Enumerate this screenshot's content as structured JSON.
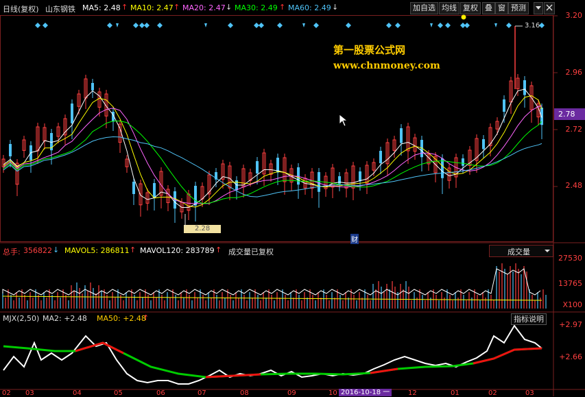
{
  "header": {
    "period": "日线(复权)",
    "stock": "山东钢铁",
    "ma5": "MA5: 2.48",
    "ma10": "MA10: 2.47",
    "ma20": "MA20: 2.47",
    "ma30": "MA30: 2.49",
    "ma60": "MA60: 2.49",
    "buttons": [
      "加自选",
      "均线",
      "复权",
      "叠",
      "窗",
      "预测"
    ],
    "close_icon": "x-icon",
    "colors": {
      "ma5": "#ffffff",
      "ma10": "#ffff00",
      "ma20": "#ff66ff",
      "ma30": "#00ff00",
      "ma60": "#4fc3f7"
    }
  },
  "price_axis": {
    "ticks": [
      "3.20",
      "2.96",
      "2.72",
      "2.48"
    ],
    "current": "2.78",
    "high_label": "3.16",
    "low_label": "2.28"
  },
  "watermark": {
    "title": "第一股票公式网",
    "url": "www.chnmoney.com"
  },
  "fin_marker": "财",
  "volume_panel": {
    "total_label": "总手:",
    "total_value": "356822",
    "mavol5": "MAVOL5: 286811",
    "mavol120": "MAVOL120: 283789",
    "note": "成交量已复权",
    "dropdown": "成交量",
    "ticks": [
      "27530",
      "13765",
      "X100"
    ]
  },
  "indicator_panel": {
    "title": "MJX(2,50)",
    "ma2": "MA2: +2.48",
    "ma50": "MA50: +2.48",
    "button": "指标说明",
    "ticks": [
      "+2.97",
      "+2.66"
    ]
  },
  "time_axis": {
    "labels": [
      "02",
      "03",
      "04",
      "05",
      "06",
      "07",
      "08",
      "09",
      "10",
      "2016-10-18 一",
      "12",
      "01",
      "02",
      "03"
    ],
    "highlight": "2016-10-18 一"
  },
  "arrows": {
    "up": "↑",
    "down": "↓"
  }
}
